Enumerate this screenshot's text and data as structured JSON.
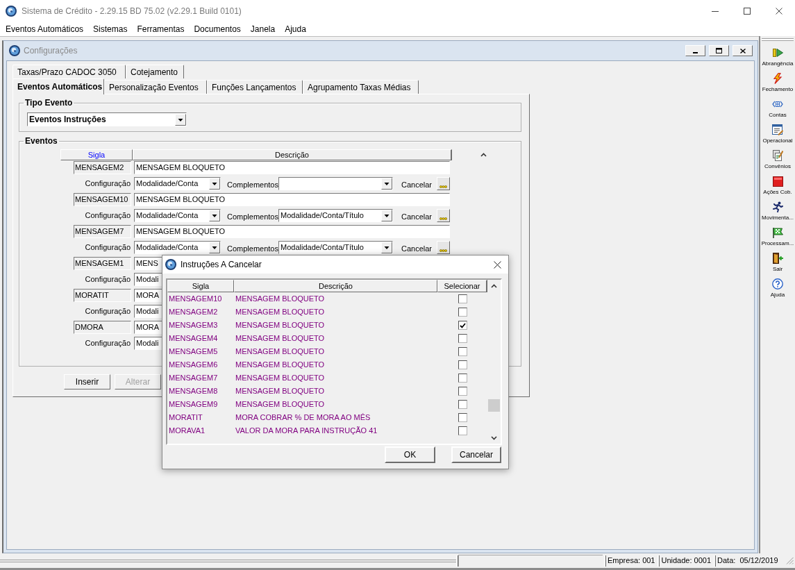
{
  "window": {
    "title": "Sistema de Crédito - 2.29.15 BD 75.02 (v2.29.1 Build 0101)"
  },
  "menu": [
    "Eventos Automáticos",
    "Sistemas",
    "Ferramentas",
    "Documentos",
    "Janela",
    "Ajuda"
  ],
  "config_window": {
    "title": "Configurações",
    "tab_rows": [
      [
        {
          "label": "Taxas/Prazo CADOC 3050",
          "selected": false
        },
        {
          "label": "Cotejamento",
          "selected": false
        }
      ],
      [
        {
          "label": "Eventos Automáticos",
          "selected": true
        },
        {
          "label": "Personalização Eventos",
          "selected": false
        },
        {
          "label": "Funções Lançamentos",
          "selected": false
        },
        {
          "label": "Agrupamento Taxas Médias",
          "selected": false
        }
      ]
    ],
    "tipo_evento": {
      "label": "Tipo Evento",
      "value": "Eventos Instruções"
    },
    "eventos": {
      "label": "Eventos",
      "columns": [
        {
          "label": "Sigla",
          "highlighted": true
        },
        {
          "label": "Descrição",
          "highlighted": false
        }
      ],
      "rows": [
        {
          "sigla": "MENSAGEM2",
          "descricao": "MENSAGEM BLOQUETO",
          "configuracao_label": "Configuração",
          "configuracao": "Modalidade/Conta",
          "complementos_label": "Complementos",
          "cancelar_label": "Cancelar"
        },
        {
          "sigla": "MENSAGEM10",
          "descricao": "MENSAGEM BLOQUETO",
          "configuracao_label": "Configuração",
          "configuracao": "Modalidade/Conta",
          "complementos_label": "Complementos",
          "complementos": "Modalidade/Conta/Título",
          "cancelar_label": "Cancelar"
        },
        {
          "sigla": "MENSAGEM7",
          "descricao": "MENSAGEM BLOQUETO",
          "configuracao_label": "Configuração",
          "configuracao": "Modalidade/Conta",
          "complementos_label": "Complementos",
          "complementos": "Modalidade/Conta/Título",
          "cancelar_label": "Cancelar"
        },
        {
          "sigla": "MENSAGEM1",
          "descricao": "MENS",
          "configuracao_label": "Configuração",
          "configuracao": "Modali"
        },
        {
          "sigla": "MORATIT",
          "descricao": "MORA",
          "configuracao_label": "Configuração",
          "configuracao": "Modali"
        },
        {
          "sigla": "DMORA",
          "descricao": "MORA",
          "configuracao_label": "Configuração",
          "configuracao": "Modali"
        }
      ]
    },
    "buttons": [
      {
        "label": "Inserir",
        "disabled": false
      },
      {
        "label": "Alterar",
        "disabled": true
      }
    ]
  },
  "dialog": {
    "title": "Instruções A Cancelar",
    "columns": [
      "Sigla",
      "Descrição",
      "Selecionar"
    ],
    "rows": [
      {
        "sigla": "MENSAGEM10",
        "descricao": "MENSAGEM BLOQUETO",
        "checked": false
      },
      {
        "sigla": "MENSAGEM2",
        "descricao": "MENSAGEM BLOQUETO",
        "checked": false
      },
      {
        "sigla": "MENSAGEM3",
        "descricao": "MENSAGEM BLOQUETO",
        "checked": true
      },
      {
        "sigla": "MENSAGEM4",
        "descricao": "MENSAGEM BLOQUETO",
        "checked": false
      },
      {
        "sigla": "MENSAGEM5",
        "descricao": "MENSAGEM BLOQUETO",
        "checked": false
      },
      {
        "sigla": "MENSAGEM6",
        "descricao": "MENSAGEM BLOQUETO",
        "checked": false
      },
      {
        "sigla": "MENSAGEM7",
        "descricao": "MENSAGEM BLOQUETO",
        "checked": false
      },
      {
        "sigla": "MENSAGEM8",
        "descricao": "MENSAGEM BLOQUETO",
        "checked": false
      },
      {
        "sigla": "MENSAGEM9",
        "descricao": "MENSAGEM BLOQUETO",
        "checked": false
      },
      {
        "sigla": "MORATIT",
        "descricao": "MORA COBRAR % DE MORA AO MÊS",
        "checked": false
      },
      {
        "sigla": "MORAVA1",
        "descricao": "VALOR DA MORA PARA INSTRUÇÃO 41",
        "checked": false
      }
    ],
    "buttons": [
      "OK",
      "Cancelar"
    ]
  },
  "toolbar": [
    "Abrangência",
    "Fechamento",
    "Contas",
    "Operacional",
    "Convênios",
    "Ações Cob.",
    "Movimenta...",
    "Processam...",
    "Sair",
    "Ajuda"
  ],
  "status_bar": [
    "Empresa: 001",
    "Unidade: 0001",
    "Data:  05/12/2019"
  ]
}
